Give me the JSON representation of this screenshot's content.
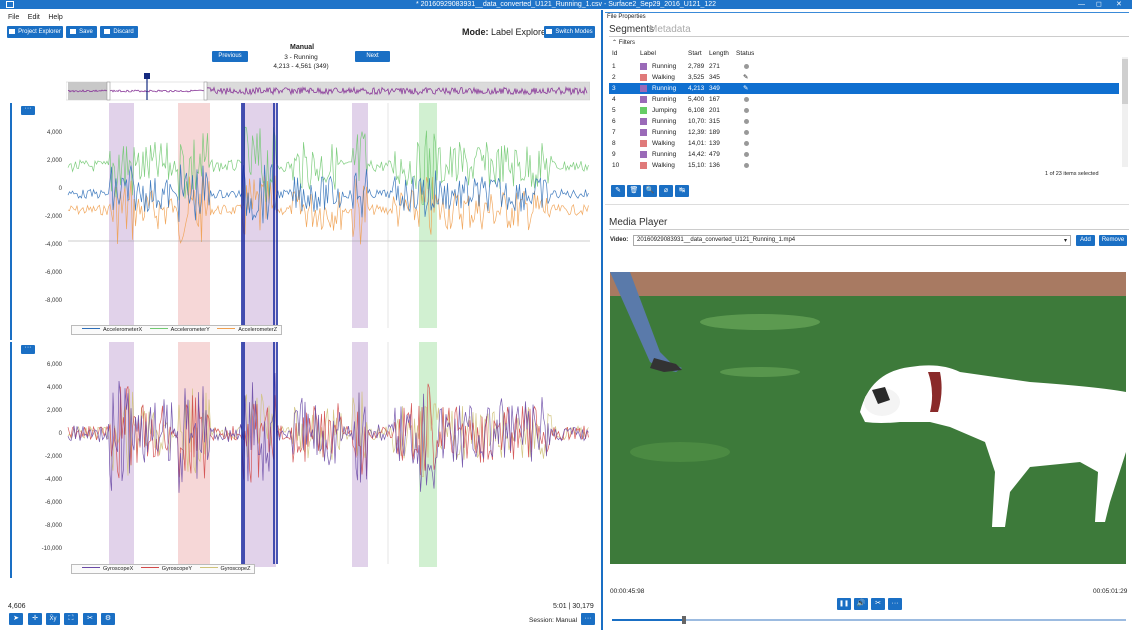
{
  "window": {
    "title": "* 20160929083931__data_converted_U121_Running_1.csv - Surface2_Sep29_2016_U121_122",
    "controls": [
      "—",
      "◻",
      "✕"
    ]
  },
  "menu": [
    "File",
    "Edit",
    "Help"
  ],
  "toolbar": {
    "project_explorer": "Project Explorer",
    "save": "Save",
    "discard": "Discard",
    "mode_label": "Mode:",
    "mode_value": "Label Explorer",
    "switch_modes": "Switch Modes"
  },
  "navigator": {
    "mode": "Manual",
    "current_segment": "3 - Running",
    "range": "4,213 - 4,561 (349)",
    "previous": "Previous",
    "next": "Next"
  },
  "plot1": {
    "menu_label": "···",
    "yticks": [
      "4,000",
      "2,000",
      "0",
      "-2,000",
      "-4,000",
      "-6,000",
      "-8,000"
    ],
    "legend": [
      {
        "name": "AccelerometerX",
        "color": "#2f6fb8"
      },
      {
        "name": "AccelerometerY",
        "color": "#72c972"
      },
      {
        "name": "AccelerometerZ",
        "color": "#f0a050"
      }
    ]
  },
  "plot2": {
    "menu_label": "···",
    "yticks": [
      "6,000",
      "4,000",
      "2,000",
      "0",
      "-2,000",
      "-4,000",
      "-6,000",
      "-8,000",
      "-10,000"
    ],
    "legend": [
      {
        "name": "GyroscopeX",
        "color": "#6a4aa6"
      },
      {
        "name": "GyroscopeY",
        "color": "#d24a4a"
      },
      {
        "name": "GyroscopeZ",
        "color": "#cfc27a"
      }
    ]
  },
  "statusbar": {
    "cursor_value": "4,606",
    "time": "5:01",
    "sep": "|",
    "sample": "30,179",
    "session_label": "Session:",
    "session_value": "Manual",
    "more": "···"
  },
  "bottom_tools": [
    "➤",
    "✛",
    "X̄y",
    "⛶",
    "✂",
    "⚙"
  ],
  "file_properties": {
    "label": "File Properties",
    "tab_segments": "Segments",
    "tab_metadata": "Metadata",
    "filters": "Filters",
    "columns": [
      "Id",
      "Label",
      "Start",
      "Length",
      "Status"
    ],
    "rows": [
      {
        "id": "1",
        "label": "Running",
        "start": "2,789",
        "length": "271",
        "color": "#9a6ab8",
        "status": "dot"
      },
      {
        "id": "2",
        "label": "Walking",
        "start": "3,525",
        "length": "345",
        "color": "#e07a7a",
        "status": "pencil"
      },
      {
        "id": "3",
        "label": "Running",
        "start": "4,213",
        "length": "349",
        "color": "#9a6ab8",
        "status": "pencil"
      },
      {
        "id": "4",
        "label": "Running",
        "start": "5,400",
        "length": "167",
        "color": "#9a6ab8",
        "status": "dot"
      },
      {
        "id": "5",
        "label": "Jumping",
        "start": "6,108",
        "length": "201",
        "color": "#66cc66",
        "status": "dot"
      },
      {
        "id": "6",
        "label": "Running",
        "start": "10,70:",
        "length": "315",
        "color": "#9a6ab8",
        "status": "dot"
      },
      {
        "id": "7",
        "label": "Running",
        "start": "12,39:",
        "length": "189",
        "color": "#9a6ab8",
        "status": "dot"
      },
      {
        "id": "8",
        "label": "Walking",
        "start": "14,01:",
        "length": "139",
        "color": "#e07a7a",
        "status": "dot"
      },
      {
        "id": "9",
        "label": "Running",
        "start": "14,42:",
        "length": "479",
        "color": "#9a6ab8",
        "status": "dot"
      },
      {
        "id": "10",
        "label": "Walking",
        "start": "15,10:",
        "length": "136",
        "color": "#e07a7a",
        "status": "dot"
      }
    ],
    "selected_row": 2,
    "count_text": "1 of 23 items selected",
    "actions": [
      "✎",
      "🗑",
      "🔍",
      "⌀",
      "↹"
    ]
  },
  "media_player": {
    "title": "Media Player",
    "video_label": "Video:",
    "video_file": "20160929083931__data_converted_U121_Running_1.mp4",
    "add": "Add",
    "remove": "Remove",
    "time_current": "00:00:45:98",
    "time_total": "00:05:01:29",
    "progress": 0.14,
    "controls": [
      "❚❚",
      "🔊",
      "✂",
      "···"
    ]
  },
  "colors": {
    "accent": "#1a6fc4",
    "running": "#9a6ab8",
    "walking": "#e07a7a",
    "jumping": "#66cc66"
  }
}
